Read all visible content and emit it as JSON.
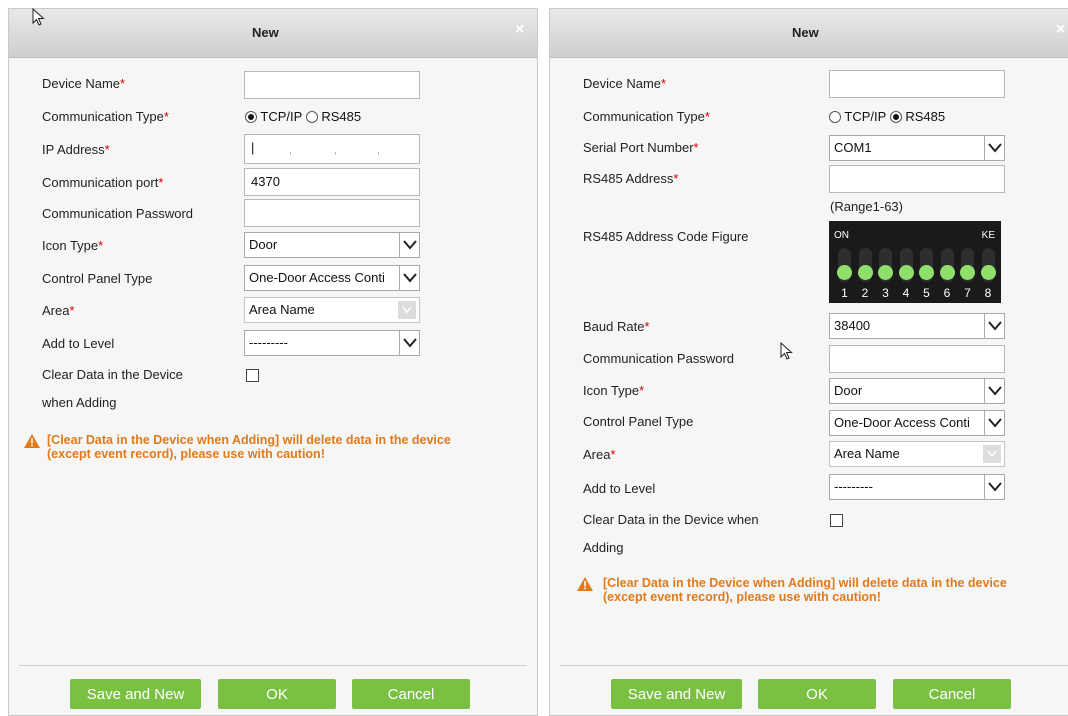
{
  "left_dialog": {
    "title": "New",
    "close_glyph": "×",
    "fields": {
      "device_name": {
        "label": "Device Name",
        "required": "*",
        "value": ""
      },
      "comm_type": {
        "label": "Communication Type",
        "required": "*",
        "options": [
          "TCP/IP",
          "RS485"
        ],
        "selected": "TCP/IP"
      },
      "ip_address": {
        "label": "IP Address",
        "required": "*",
        "value": "|"
      },
      "comm_port": {
        "label": "Communication port",
        "required": "*",
        "value": "4370"
      },
      "comm_password": {
        "label": "Communication Password",
        "value": ""
      },
      "icon_type": {
        "label": "Icon Type",
        "required": "*",
        "value": "Door"
      },
      "panel_type": {
        "label": "Control Panel Type",
        "value": "One-Door Access Conti"
      },
      "area": {
        "label": "Area",
        "required": "*",
        "value": "Area Name"
      },
      "add_to_level": {
        "label": "Add to Level",
        "value": "---------"
      },
      "clear_data": {
        "label_line1": "Clear Data in the Device",
        "label_line2": "when Adding",
        "checked": false
      }
    },
    "warning": {
      "line1": "[Clear Data in the Device when Adding] will delete data in the device",
      "line2": "(except event record), please use with caution!"
    },
    "buttons": {
      "save_new": "Save and New",
      "ok": "OK",
      "cancel": "Cancel"
    }
  },
  "right_dialog": {
    "title": "New",
    "close_glyph": "×",
    "fields": {
      "device_name": {
        "label": "Device Name",
        "required": "*",
        "value": ""
      },
      "comm_type": {
        "label": "Communication Type",
        "required": "*",
        "options": [
          "TCP/IP",
          "RS485"
        ],
        "selected": "RS485"
      },
      "serial_port": {
        "label": "Serial Port Number",
        "required": "*",
        "value": "COM1"
      },
      "rs485_address": {
        "label": "RS485 Address",
        "required": "*",
        "value": "",
        "hint": "(Range1-63)"
      },
      "rs485_code_figure": {
        "label": "RS485 Address Code Figure",
        "on_label": "ON",
        "ke_label": "KE",
        "switch_numbers": [
          "1",
          "2",
          "3",
          "4",
          "5",
          "6",
          "7",
          "8"
        ]
      },
      "baud_rate": {
        "label": "Baud Rate",
        "required": "*",
        "value": "38400"
      },
      "comm_password": {
        "label": "Communication Password",
        "value": ""
      },
      "icon_type": {
        "label": "Icon Type",
        "required": "*",
        "value": "Door"
      },
      "panel_type": {
        "label": "Control Panel Type",
        "value": "One-Door Access Conti"
      },
      "area": {
        "label": "Area",
        "required": "*",
        "value": "Area Name"
      },
      "add_to_level": {
        "label": "Add to Level",
        "value": "---------"
      },
      "clear_data": {
        "label_line1": "Clear Data in the Device when",
        "label_line2": "Adding",
        "checked": false
      }
    },
    "warning": {
      "line1": "[Clear Data in the Device when Adding] will delete data in the device",
      "line2": "(except event record), please use with caution!"
    },
    "buttons": {
      "save_new": "Save and New",
      "ok": "OK",
      "cancel": "Cancel"
    }
  },
  "colors": {
    "button_green": "#7ac143",
    "warning_orange": "#e07a1a",
    "required_red": "#d40000",
    "dip_knob_green": "#8ee06a"
  }
}
